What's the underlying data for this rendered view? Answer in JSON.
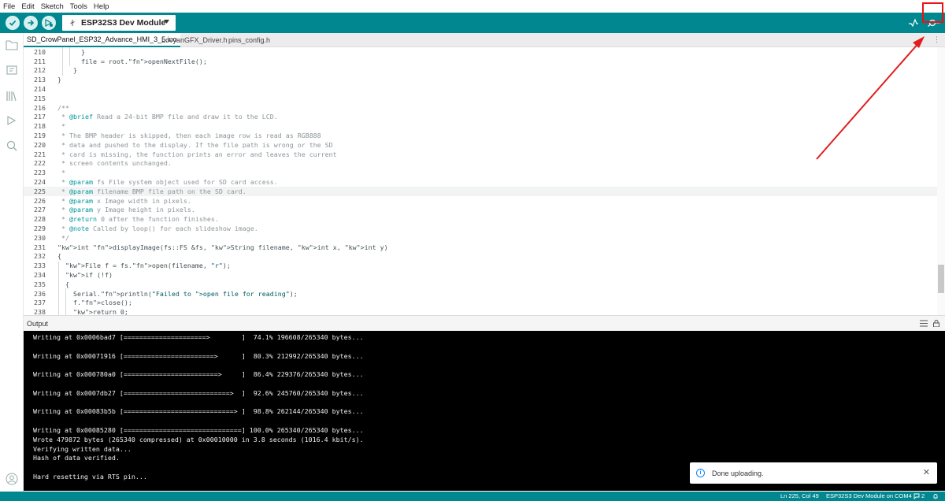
{
  "menu": [
    "File",
    "Edit",
    "Sketch",
    "Tools",
    "Help"
  ],
  "toolbar": {
    "board": "ESP32S3 Dev Module",
    "verify_icon": "check-icon",
    "upload_icon": "arrow-right-icon",
    "debug_icon": "debugger-icon",
    "serial_plotter_icon": "pulse-icon",
    "serial_monitor_icon": "magnifier-icon"
  },
  "tabs": [
    "SD_CrowPanel_ESP32_Advance_HMI_3_5.ino",
    "LovyanGFX_Driver.h",
    "pins_config.h"
  ],
  "tabs_more": "⋮",
  "editor": {
    "lines": [
      {
        "n": "210",
        "t": "      }"
      },
      {
        "n": "211",
        "t": "      file = root.openNextFile();"
      },
      {
        "n": "212",
        "t": "    }"
      },
      {
        "n": "213",
        "t": "}"
      },
      {
        "n": "214",
        "t": ""
      },
      {
        "n": "215",
        "t": ""
      },
      {
        "n": "216",
        "t": "/**"
      },
      {
        "n": "217",
        "t": " * @brief Read a 24-bit BMP file and draw it to the LCD."
      },
      {
        "n": "218",
        "t": " *"
      },
      {
        "n": "219",
        "t": " * The BMP header is skipped, then each image row is read as RGB888"
      },
      {
        "n": "220",
        "t": " * data and pushed to the display. If the file path is wrong or the SD"
      },
      {
        "n": "221",
        "t": " * card is missing, the function prints an error and leaves the current"
      },
      {
        "n": "222",
        "t": " * screen contents unchanged."
      },
      {
        "n": "223",
        "t": " *"
      },
      {
        "n": "224",
        "t": " * @param fs File system object used for SD card access."
      },
      {
        "n": "225",
        "t": " * @param filename BMP file path on the SD card."
      },
      {
        "n": "226",
        "t": " * @param x Image width in pixels."
      },
      {
        "n": "227",
        "t": " * @param y Image height in pixels."
      },
      {
        "n": "228",
        "t": " * @return 0 after the function finishes."
      },
      {
        "n": "229",
        "t": " * @note Called by loop() for each slideshow image."
      },
      {
        "n": "230",
        "t": " */"
      },
      {
        "n": "231",
        "t": "int displayImage(fs::FS &fs, String filename, int x, int y)"
      },
      {
        "n": "232",
        "t": "{"
      },
      {
        "n": "233",
        "t": "  File f = fs.open(filename, \"r\");"
      },
      {
        "n": "234",
        "t": "  if (!f)"
      },
      {
        "n": "235",
        "t": "  {"
      },
      {
        "n": "236",
        "t": "    Serial.println(\"Failed to open file for reading\");"
      },
      {
        "n": "237",
        "t": "    f.close();"
      },
      {
        "n": "238",
        "t": "    return 0;"
      }
    ]
  },
  "output": {
    "title": "Output",
    "lines": [
      "Writing at 0x0006bad7 [=====================>        ]  74.1% 196608/265340 bytes...",
      "",
      "Writing at 0x00071916 [=======================>      ]  80.3% 212992/265340 bytes...",
      "",
      "Writing at 0x000780a0 [========================>     ]  86.4% 229376/265340 bytes...",
      "",
      "Writing at 0x0007db27 [===========================>  ]  92.6% 245760/265340 bytes...",
      "",
      "Writing at 0x00083b5b [============================> ]  98.8% 262144/265340 bytes...",
      "",
      "Writing at 0x00085280 [==============================] 100.0% 265340/265340 bytes...",
      "Wrote 479872 bytes (265340 compressed) at 0x00010000 in 3.8 seconds (1016.4 kbit/s).",
      "Verifying written data...",
      "Hash of data verified.",
      "",
      "Hard resetting via RTS pin..."
    ]
  },
  "toast": {
    "message": "Done uploading.",
    "close": "✕",
    "info": "i"
  },
  "status": {
    "position": "Ln 225, Col 49",
    "board": "ESP32S3 Dev Module on COM4",
    "notifications": "2"
  },
  "colors": {
    "teal": "#00878f",
    "annotation_red": "#e11d1d"
  }
}
